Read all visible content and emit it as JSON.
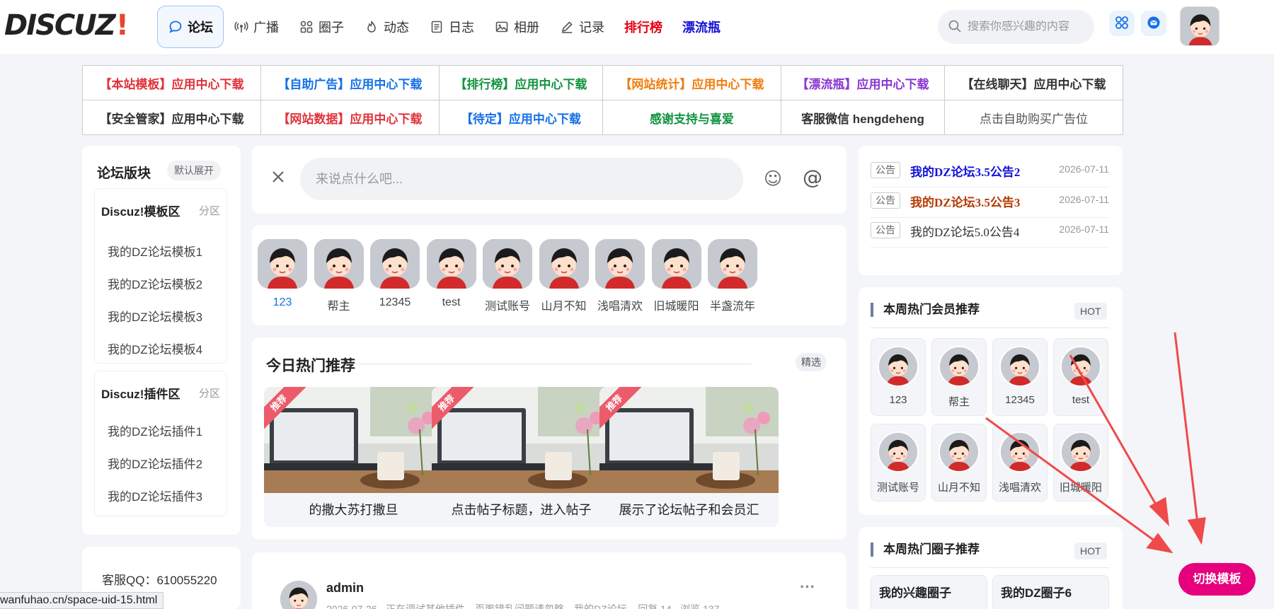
{
  "logo": {
    "text": "DISCUZ",
    "mark": "!"
  },
  "nav": {
    "items": [
      {
        "label": "论坛",
        "icon": "chat-bubble-icon",
        "active": true
      },
      {
        "label": "广播",
        "icon": "broadcast-icon"
      },
      {
        "label": "圈子",
        "icon": "grid-icon"
      },
      {
        "label": "动态",
        "icon": "flame-icon"
      },
      {
        "label": "日志",
        "icon": "document-icon"
      },
      {
        "label": "相册",
        "icon": "image-icon"
      },
      {
        "label": "记录",
        "icon": "pencil-icon"
      },
      {
        "label": "排行榜",
        "style": "red"
      },
      {
        "label": "漂流瓶",
        "style": "blue"
      }
    ]
  },
  "search": {
    "placeholder": "搜索你感兴趣的内容"
  },
  "ads": {
    "rows": [
      [
        {
          "text": "【本站模板】应用中心下载",
          "color": "#e0323a"
        },
        {
          "text": "【自助广告】应用中心下载",
          "color": "#1570e8"
        },
        {
          "text": "【排行榜】应用中心下载",
          "color": "#129440"
        },
        {
          "text": "【网站统计】应用中心下载",
          "color": "#f07d0c"
        },
        {
          "text": "【漂流瓶】应用中心下载",
          "color": "#8a36cf"
        },
        {
          "text": "【在线聊天】应用中心下载",
          "color": "#333333"
        }
      ],
      [
        {
          "text": "【安全管家】应用中心下载",
          "color": "#333333"
        },
        {
          "text": "【网站数据】应用中心下载",
          "color": "#e0323a"
        },
        {
          "text": "【待定】应用中心下载",
          "color": "#1570e8"
        },
        {
          "text": "感谢支持与喜爱",
          "color": "#129440"
        },
        {
          "text": "客服微信 hengdeheng",
          "color": "#333333"
        },
        {
          "text": "点击自助购买广告位",
          "color": "#555555",
          "normal": true
        }
      ]
    ]
  },
  "forum": {
    "title": "论坛版块",
    "toggle": "默认展开",
    "sections": [
      {
        "name": "Discuz!模板区",
        "tag": "分区",
        "items": [
          "我的DZ论坛模板1",
          "我的DZ论坛模板2",
          "我的DZ论坛模板3",
          "我的DZ论坛模板4"
        ]
      },
      {
        "name": "Discuz!插件区",
        "tag": "分区",
        "items": [
          "我的DZ论坛插件1",
          "我的DZ论坛插件2",
          "我的DZ论坛插件3"
        ]
      }
    ]
  },
  "qq": "客服QQ：610055220",
  "post": {
    "placeholder": "来说点什么吧..."
  },
  "users": [
    "123",
    "帮主",
    "12345",
    "test",
    "测试账号",
    "山月不知",
    "浅唱清欢",
    "旧城暖阳",
    "半盏流年"
  ],
  "hot": {
    "title": "今日热门推荐",
    "badge": "精选",
    "ribbon": "推荐",
    "tiles": [
      "的撒大苏打撒旦",
      "点击帖子标题，进入帖子",
      "展示了论坛帖子和会员汇"
    ]
  },
  "feed": {
    "name": "admin",
    "meta": "2026-07-26 · 正在调试其他插件，页面错乱问题请忽略，我的DZ论坛...   回复 14 · 浏览 137",
    "more": "···"
  },
  "notices": [
    {
      "tag": "公告",
      "title": "我的DZ论坛3.5公告2",
      "date": "2026-07-11",
      "color": "#1212d8"
    },
    {
      "tag": "公告",
      "title": "我的DZ论坛3.5公告3",
      "date": "2026-07-11",
      "color": "#b33a00"
    },
    {
      "tag": "公告",
      "title": "我的DZ论坛5.0公告4",
      "date": "2026-07-11",
      "color": "#333333"
    }
  ],
  "members": {
    "title": "本周热门会员推荐",
    "badge": "HOT",
    "list": [
      "123",
      "帮主",
      "12345",
      "test",
      "测试账号",
      "山月不知",
      "浅唱清欢",
      "旧城暖阳"
    ]
  },
  "circles": {
    "title": "本周热门圈子推荐",
    "badge": "HOT",
    "list": [
      "我的兴趣圈子",
      "我的DZ圈子6"
    ]
  },
  "switch_button": "切换模板",
  "status_url": "wanfuhao.cn/space-uid-15.html",
  "colors": {
    "accent_blue": "#1570e8",
    "switch_pink": "#e6007e",
    "arrow_red": "#ef4a4a"
  }
}
